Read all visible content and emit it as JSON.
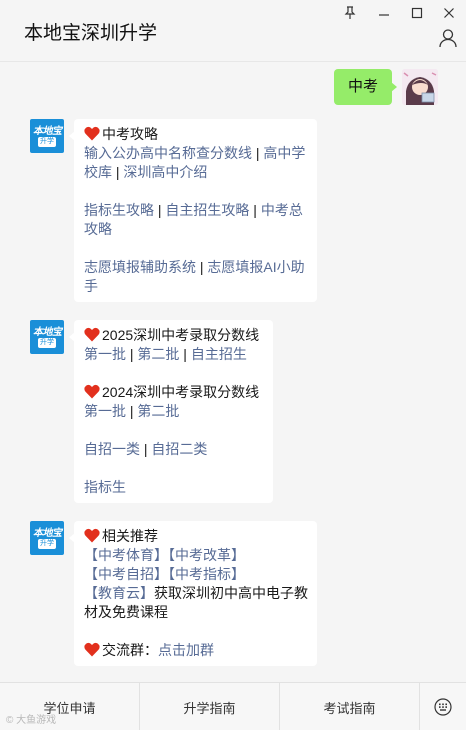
{
  "window": {
    "title": "本地宝深圳升学",
    "controls": [
      "pin-icon",
      "minimize-icon",
      "maximize-icon",
      "close-icon"
    ]
  },
  "user_message": {
    "text": "中考"
  },
  "bot_avatar": {
    "line1": "本地宝",
    "line2": "升学"
  },
  "messages": [
    {
      "heading": "中考攻略",
      "rows": [
        [
          "输入公办高中名称查分数线",
          " | ",
          "高中学"
        ],
        [
          "校库",
          " | ",
          "深圳高中介绍"
        ],
        [],
        [
          "指标生攻略",
          " | ",
          "自主招生攻略",
          " | ",
          "中考总"
        ],
        [
          "攻略"
        ],
        [],
        [
          "志愿填报辅助系统",
          " | ",
          "志愿填报AI小助"
        ],
        [
          "手"
        ]
      ]
    },
    {
      "heading1": "2025深圳中考录取分数线",
      "row1": [
        "第一批",
        " | ",
        "第二批",
        " | ",
        "自主招生"
      ],
      "heading2": "2024深圳中考录取分数线",
      "row2": [
        "第一批",
        " | ",
        "第二批"
      ],
      "row3": [
        "自招一类",
        " | ",
        "自招二类"
      ],
      "row4": [
        "指标生"
      ]
    },
    {
      "heading": "相关推荐",
      "row1": [
        "【中考体育】",
        "【中考改革】"
      ],
      "row2": [
        "【中考自招】",
        "【中考指标】"
      ],
      "row3_link": "【教育云】",
      "row3_text": "获取深圳初中高中电子教",
      "row4_text": "材及免费课程",
      "group_label": "交流群：",
      "group_link": "点击加群"
    }
  ],
  "bottom_tabs": [
    "学位申请",
    "升学指南",
    "考试指南"
  ],
  "watermark": "© 大鱼游戏",
  "colors": {
    "link": "#576b95",
    "user_bubble": "#95ec69",
    "heart": "#e2301d",
    "bot_avatar": "#1a8fd8"
  }
}
